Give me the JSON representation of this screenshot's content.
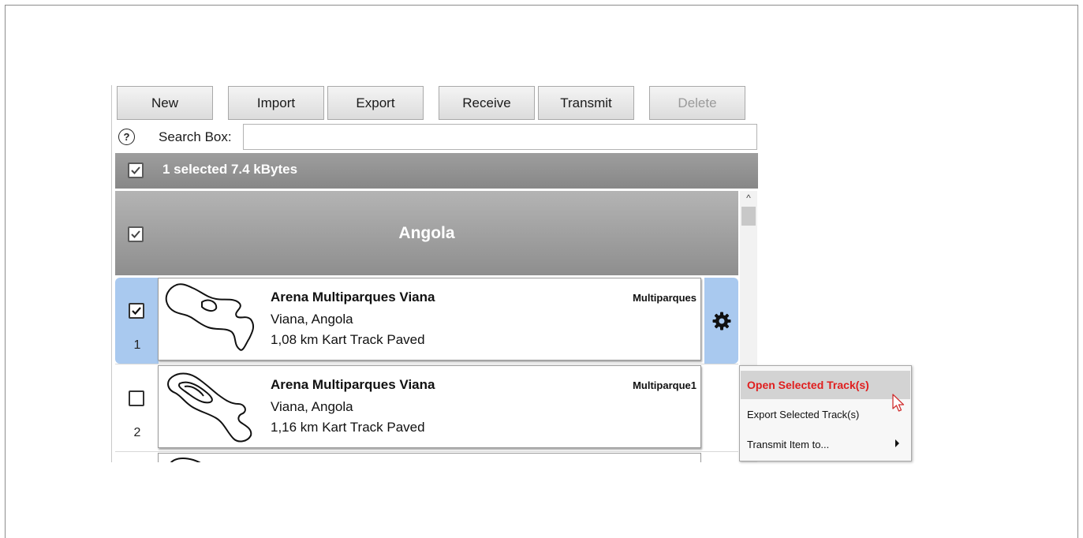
{
  "toolbar": {
    "new_label": "New",
    "import_label": "Import",
    "export_label": "Export",
    "receive_label": "Receive",
    "transmit_label": "Transmit",
    "delete_label": "Delete"
  },
  "search": {
    "help_glyph": "?",
    "label": "Search Box:",
    "value": ""
  },
  "summary": {
    "text": "1 selected 7.4 kBytes",
    "checked": true
  },
  "group": {
    "title": "Angola",
    "checked": true
  },
  "tracks": [
    {
      "number": "1",
      "name": "Arena Multiparques Viana",
      "location": "Viana, Angola",
      "info": "1,08 km Kart Track Paved",
      "tag": "Multiparques",
      "checked": true,
      "selected": true
    },
    {
      "number": "2",
      "name": "Arena Multiparques Viana",
      "location": "Viana, Angola",
      "info": "1,16 km Kart Track Paved",
      "tag": "Multiparque1",
      "checked": false,
      "selected": false
    }
  ],
  "context_menu": {
    "items": [
      {
        "label": "Open Selected Track(s)",
        "active": true
      },
      {
        "label": "Export Selected Track(s)",
        "active": false
      },
      {
        "label": "Transmit Item to...",
        "active": false,
        "submenu": true
      }
    ]
  },
  "colors": {
    "selection": "#a9c9ef",
    "header_gray": "#8e8e8e",
    "menu_highlight_text": "#e01e1e"
  },
  "icons": {
    "row_settings": "gear-icon",
    "help": "help-circle-icon",
    "check": "checkmark-icon",
    "submenu": "triangle-right-icon",
    "pointer": "mouse-cursor-icon"
  }
}
